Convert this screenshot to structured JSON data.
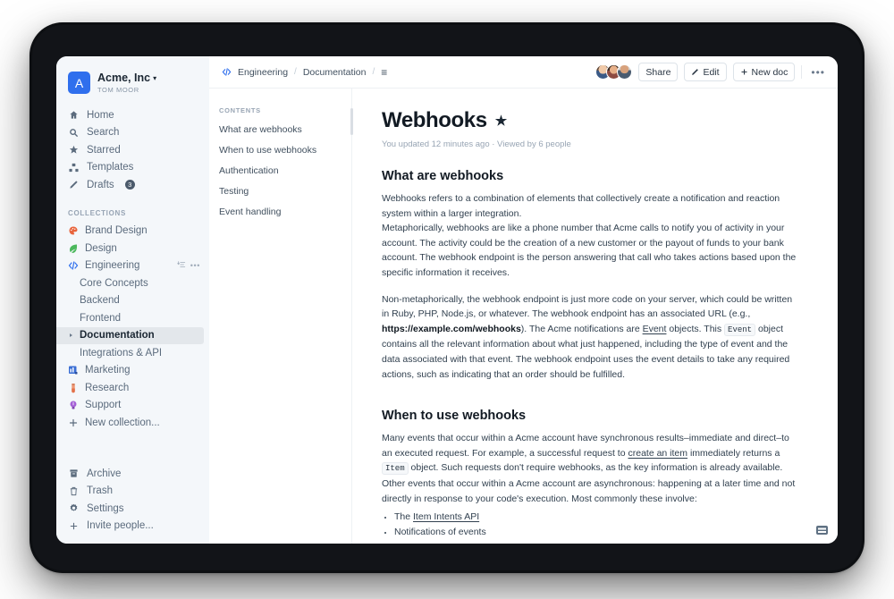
{
  "sidebar": {
    "team": {
      "initial": "A",
      "name": "Acme, Inc",
      "caret": "▾",
      "user": "TOM MOOR"
    },
    "nav": [
      {
        "label": "Home",
        "icon": "home-icon"
      },
      {
        "label": "Search",
        "icon": "search-icon"
      },
      {
        "label": "Starred",
        "icon": "star-icon"
      },
      {
        "label": "Templates",
        "icon": "templates-icon"
      },
      {
        "label": "Drafts",
        "icon": "pencil-icon",
        "badge": "3"
      }
    ],
    "collections_header": "COLLECTIONS",
    "collections": [
      {
        "label": "Brand Design",
        "icon": "palette-emoji"
      },
      {
        "label": "Design",
        "icon": "leaf-emoji"
      },
      {
        "label": "Engineering",
        "icon": "code-icon",
        "actions": [
          "sort-icon",
          "more-icon"
        ]
      }
    ],
    "engineering_docs": [
      {
        "label": "Core Concepts",
        "active": false
      },
      {
        "label": "Backend",
        "active": false
      },
      {
        "label": "Frontend",
        "active": false
      },
      {
        "label": "Documentation",
        "active": true
      },
      {
        "label": "Integrations & API",
        "active": false
      }
    ],
    "collections_rest": [
      {
        "label": "Marketing",
        "icon": "chart-emoji"
      },
      {
        "label": "Research",
        "icon": "testtube-emoji"
      },
      {
        "label": "Support",
        "icon": "lightbulb-emoji"
      },
      {
        "label": "New collection...",
        "icon": "plus-icon"
      }
    ],
    "bottom": [
      {
        "label": "Archive",
        "icon": "archive-icon"
      },
      {
        "label": "Trash",
        "icon": "trash-icon"
      },
      {
        "label": "Settings",
        "icon": "gear-icon"
      },
      {
        "label": "Invite people...",
        "icon": "plus-icon"
      }
    ]
  },
  "topbar": {
    "breadcrumb": [
      {
        "label": "Engineering",
        "icon": "code-icon"
      },
      {
        "label": "Documentation",
        "icon": ""
      },
      {
        "label": "≡",
        "icon": "menu-icon"
      }
    ],
    "separator": "/",
    "share_label": "Share",
    "edit_label": "Edit",
    "newdoc_label": "New doc",
    "more_label": "•••"
  },
  "contents": {
    "header": "CONTENTS",
    "items": [
      "What are webhooks",
      "When to use webhooks",
      "Authentication",
      "Testing",
      "Event handling"
    ]
  },
  "document": {
    "title": "Webhooks",
    "star": "★",
    "meta": "You updated 12 minutes ago · Viewed by 6 people",
    "section1_heading": "What are webhooks",
    "p1": "Webhooks refers to a combination of elements that collectively create a notification and reaction system within a larger integration.",
    "p2": "Metaphorically, webhooks are like a phone number that Acme calls to notify you of activity in your account. The activity could be the creation of a new customer or the payout of funds to your bank account. The webhook endpoint is the person answering that call who takes actions based upon the specific information it receives.",
    "p3_a": "Non-metaphorically, the webhook endpoint is just more code on your server, which could be written in Ruby, PHP, Node.js, or whatever. The webhook endpoint has an associated URL (e.g., ",
    "p3_link": "https://example.com/webhooks",
    "p3_b": "). The Acme notifications are ",
    "p3_eventlink": "Event",
    "p3_c": " objects. This ",
    "p3_code": "Event",
    "p3_d": " object contains all the relevant information about what just happened, including the type of event and the data associated with that event. The webhook endpoint uses the event details to take any required actions, such as indicating that an order should be fulfilled.",
    "section2_heading": "When to use webhooks",
    "p4_a": "Many events that occur within a Acme account have synchronous results–immediate and direct–to an executed request. For example, a successful request to ",
    "p4_link": "create an item",
    "p4_b": " immediately returns a ",
    "p4_code": "Item",
    "p4_c": " object. Such requests don't require webhooks, as the key information is already available. Other events that occur within a Acme account are asynchronous: happening at a later time and not directly in response to your code's execution. Most commonly these involve:",
    "bullet1_a": "The ",
    "bullet1_link": "Item Intents API",
    "bullet2": "Notifications of events"
  },
  "colors": {
    "accent": "#2f6fed",
    "sidebar_bg": "#f4f7fa",
    "active_row": "#e3e7eb",
    "text": "#31404f"
  }
}
